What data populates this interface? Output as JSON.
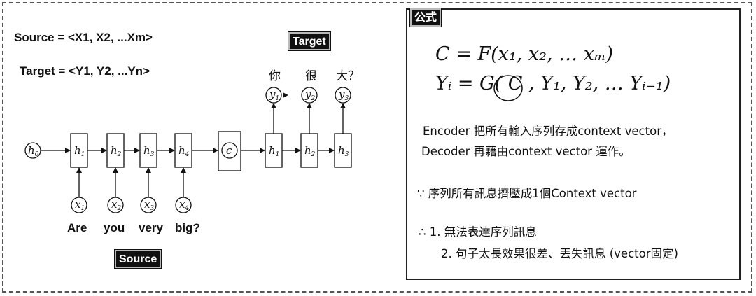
{
  "left": {
    "source_def": "Source = <X1, X2, ...Xm>",
    "target_def": "Target = <Y1, Y2, ...Yn>",
    "target_tag": "Target",
    "source_tag": "Source",
    "input_words": [
      "Are",
      "you",
      "very",
      "big?"
    ],
    "output_words": [
      "你",
      "很",
      "大？"
    ],
    "diagram": {
      "h0": "h",
      "h0_sub": "0",
      "encoder_states": [
        "h",
        "h",
        "h",
        "h"
      ],
      "encoder_subs": [
        "1",
        "2",
        "3",
        "4"
      ],
      "inputs": [
        "x",
        "x",
        "x",
        "x"
      ],
      "input_subs": [
        "1",
        "2",
        "3",
        "4"
      ],
      "context": "c",
      "decoder_states": [
        "h",
        "h",
        "h"
      ],
      "decoder_subs": [
        "1",
        "2",
        "3"
      ],
      "outputs": [
        "y",
        "y",
        "y"
      ],
      "output_subs": [
        "1",
        "2",
        "3"
      ]
    }
  },
  "panel": {
    "title": "公式",
    "formula1": "C = F(x₁, x₂, … xₘ)",
    "formula2": "Yᵢ = G( C , Y₁, Y₂, … Yᵢ₋₁)",
    "line1": "Encoder 把所有輸入序列存成context vector，",
    "line2": "Decoder 再藉由context vector 運作。",
    "because": "∵  序列所有訊息擠壓成1個Context vector",
    "therefore_1": "∴   1. 無法表達序列訊息",
    "therefore_2": "2. 句子太長效果很差、丟失訊息 (vector固定)"
  }
}
